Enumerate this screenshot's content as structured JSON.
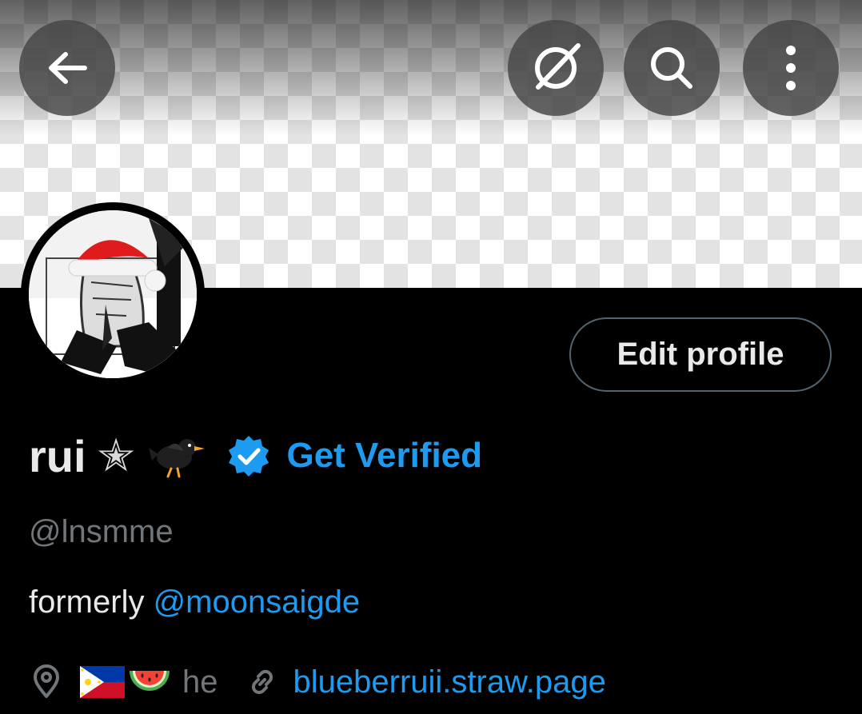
{
  "header": {
    "back_icon": "arrow-left-icon",
    "private_icon": "private-grok-icon",
    "search_icon": "search-icon",
    "more_icon": "more-vertical-icon"
  },
  "profile": {
    "display_name": "rui",
    "name_star": "✭",
    "name_emoji": "blackbird-emoji",
    "verified_badge_icon": "verified-badge-icon",
    "get_verified_label": "Get Verified",
    "handle": "@lnsmme",
    "edit_profile_label": "Edit profile",
    "bio_prefix": "formerly ",
    "bio_mention": "@moonsaigde",
    "location_icon": "location-pin-icon",
    "location_emojis": [
      "philippines-flag-emoji",
      "watermelon-emoji"
    ],
    "location_text": "he",
    "link_icon": "link-icon",
    "link_text": "blueberruii.straw.page"
  },
  "colors": {
    "background": "#000000",
    "accent": "#1d9bf0",
    "primary_text": "#e7e9ea",
    "secondary_text": "#71767b",
    "border": "#536471"
  }
}
